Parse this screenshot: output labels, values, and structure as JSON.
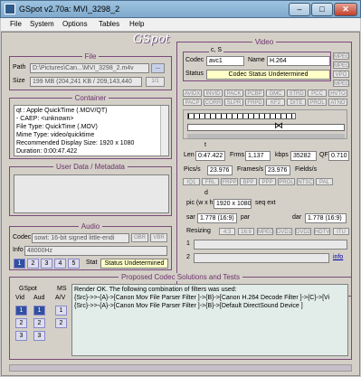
{
  "window": {
    "title": "GSpot v2.70a: MVI_3298_2",
    "minimize": "–",
    "maximize": "□",
    "close": "✕"
  },
  "menu": [
    "File",
    "System",
    "Options",
    "Tables",
    "Help"
  ],
  "logo": "GSpot",
  "file": {
    "title": "File",
    "path_label": "Path",
    "path": "D:\\Pictures\\Can...\\MVI_3298_2.m4v",
    "browse": "...",
    "size_label": "Size",
    "size": "199 MB (204,241 KB / 209,143,440",
    "page": "1/1"
  },
  "container": {
    "title": "Container",
    "lines": [
      "qt : Apple QuickTime (.MOV/QT)",
      "  - CAEP: <unknown>",
      "File Type: QuickTime (.MOV)",
      "Mime Type: video/quicktime",
      "Recommended Display Size: 1920 x 1080",
      "Duration: 0:00:47.422"
    ]
  },
  "userdata": {
    "title": "User Data / Metadata"
  },
  "audio": {
    "title": "Audio",
    "codec_label": "Codec",
    "codec": "sowt: 16-bit signed little-endi",
    "obr": "OBR",
    "vbr": "VBR",
    "info_label": "Info",
    "info": "48000Hz",
    "stat_label": "Stat",
    "status": "Status Undetermined",
    "track_buttons": [
      "1",
      "2",
      "3",
      "4",
      "5"
    ]
  },
  "video": {
    "title": "Video",
    "cs_label": "c, S",
    "codec_label": "Codec",
    "codec": "avc1",
    "name_label": "Name",
    "name": "H.264",
    "status_label": "Status",
    "status": "Codec Status Undetermined",
    "flag_buttons_right": [
      "MPEG",
      "MPEG",
      "VPO",
      "MPEG"
    ],
    "flag_row1": [
      "AVIDX",
      "INVID",
      "PACK",
      "PCBP",
      "GMC",
      "STRD",
      "PCC",
      "HVTO"
    ],
    "flag_row2": [
      "PACP",
      "CORR",
      "SLPR",
      "FRPD",
      "KF2",
      "DITE",
      "PROL",
      "ATNO"
    ],
    "length_label": "Len",
    "length": "0:47.422",
    "frms_label": "Frms",
    "frms": "1,137",
    "kbps_label": "kbps",
    "kbps": "35282",
    "qf_label": "QF",
    "qf": "0.710",
    "pics_label": "Pics/s",
    "pics": "23.976",
    "frames_label": "Frames/s",
    "frames": "23.976",
    "fields_label": "Fields/s",
    "frame_types": [
      "IQ1",
      "FRL",
      "FRPP",
      "BPP",
      "PPP",
      "PROL",
      "NTSC",
      "PAL"
    ],
    "pic_label": "pic (w x h)",
    "pic": "1920 x 1080",
    "seq_label": "seq ext",
    "sar_label": "sar",
    "sar": "1.778 (16:9)",
    "par_label": "par",
    "dar_label": "dar",
    "dar": "1.778 (16:9)",
    "resizing_label": "Resizing",
    "resize_buttons": [
      "4:3",
      "16:9",
      "MPEG",
      "DVD1",
      "DVD2",
      "HDTV",
      "ITU"
    ],
    "row1": "1",
    "row2": "2",
    "info_link": "info",
    "d_label": "d",
    "t_label": "t"
  },
  "proposed": {
    "title": "Proposed Codec Solutions and Tests",
    "gspot_label": "GSpot",
    "vid_label": "Vid",
    "aud_label": "Aud",
    "ms_label": "MS",
    "av_label": "A/V",
    "render_lines": [
      "Render OK. The following combination of filters was used:",
      "{Src}->>-{A}->[Canon Mov File Parser Filter ]->{B}->[Canon H.264 Decode Filter ]->{C}->[Vi",
      "{Src}->>-{A}->[Canon Mov File Parser Filter ]->{B}->[Default DirectSound Device ]"
    ],
    "vid_buttons": [
      "1",
      "2",
      "3"
    ],
    "aud_buttons": [
      "1",
      "2",
      "3"
    ],
    "ms_buttons": [
      "1",
      "2"
    ]
  }
}
